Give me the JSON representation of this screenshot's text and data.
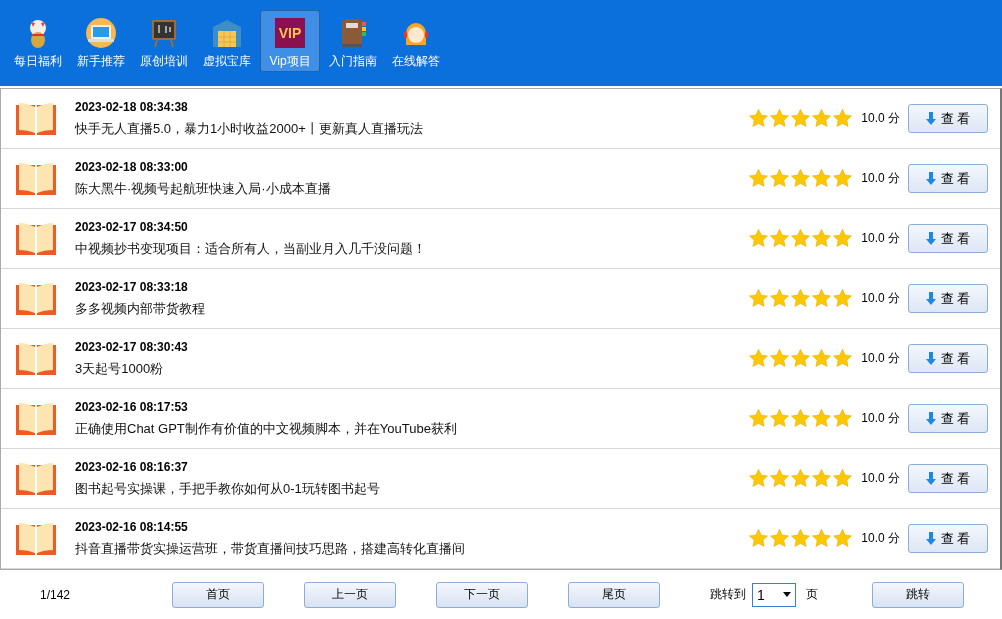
{
  "nav": [
    {
      "label": "每日福利",
      "selected": false
    },
    {
      "label": "新手推荐",
      "selected": false
    },
    {
      "label": "原创培训",
      "selected": false
    },
    {
      "label": "虚拟宝库",
      "selected": false
    },
    {
      "label": "VIP",
      "sub": "Vip项目",
      "selected": true
    },
    {
      "label": "入门指南",
      "selected": false
    },
    {
      "label": "在线解答",
      "selected": false
    }
  ],
  "items": [
    {
      "time": "2023-02-18 08:34:38",
      "title": "快手无人直播5.0，暴力1小时收益2000+丨更新真人直播玩法",
      "stars": 5,
      "score": "10.0 分",
      "button": "查 看"
    },
    {
      "time": "2023-02-18 08:33:00",
      "title": "陈大黑牛·视频号起航班快速入局·小成本直播",
      "stars": 5,
      "score": "10.0 分",
      "button": "查 看"
    },
    {
      "time": "2023-02-17 08:34:50",
      "title": "中视频抄书变现项目：适合所有人，当副业月入几千没问题！",
      "stars": 5,
      "score": "10.0 分",
      "button": "查 看"
    },
    {
      "time": "2023-02-17 08:33:18",
      "title": "多多视频内部带货教程",
      "stars": 5,
      "score": "10.0 分",
      "button": "查 看"
    },
    {
      "time": "2023-02-17 08:30:43",
      "title": "3天起号1000粉",
      "stars": 5,
      "score": "10.0 分",
      "button": "查 看"
    },
    {
      "time": "2023-02-16 08:17:53",
      "title": "正确使用Chat GPT制作有价值的中文视频脚本，并在YouTube获利",
      "stars": 5,
      "score": "10.0 分",
      "button": "查 看"
    },
    {
      "time": "2023-02-16 08:16:37",
      "title": "图书起号实操课，手把手教你如何从0-1玩转图书起号",
      "stars": 5,
      "score": "10.0 分",
      "button": "查 看"
    },
    {
      "time": "2023-02-16 08:14:55",
      "title": "抖音直播带货实操运营班，带货直播间技巧思路，搭建高转化直播间",
      "stars": 5,
      "score": "10.0 分",
      "button": "查 看"
    }
  ],
  "pager": {
    "page": "1/142",
    "buttons": [
      "首页",
      "上一页",
      "下一页",
      "尾页"
    ],
    "jump_label": "跳转到",
    "jump_value": "1",
    "page_unit": "页",
    "jump_button": "跳转"
  }
}
